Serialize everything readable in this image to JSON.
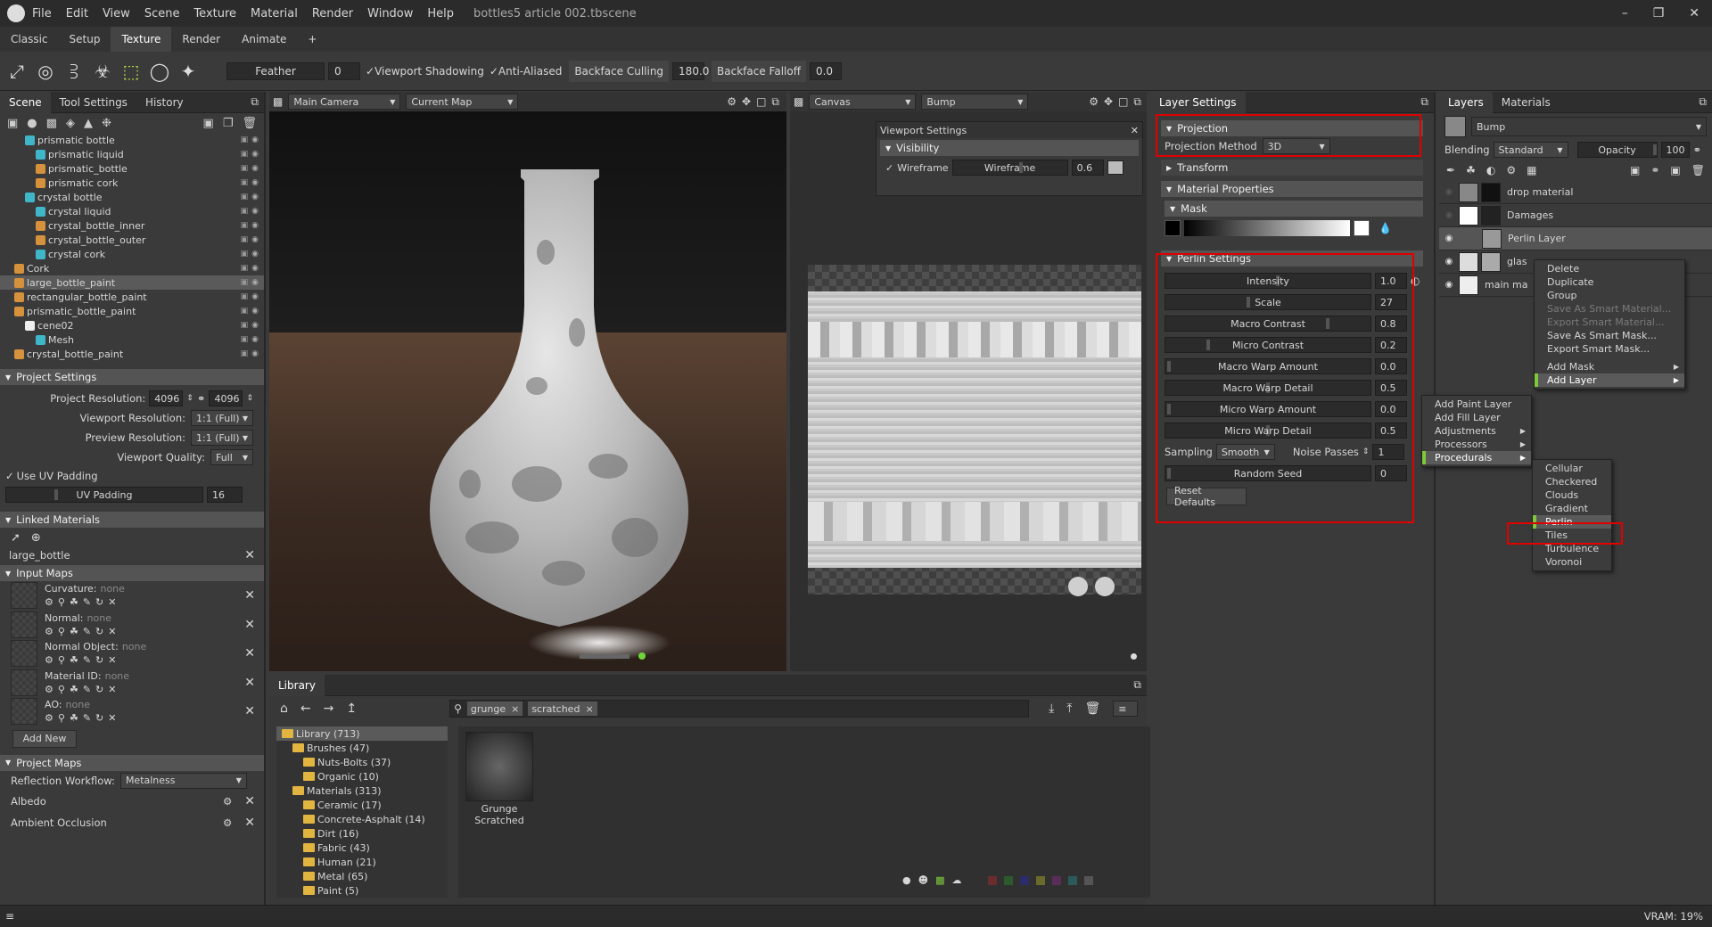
{
  "app": {
    "menu": [
      "File",
      "Edit",
      "View",
      "Scene",
      "Texture",
      "Material",
      "Render",
      "Window",
      "Help"
    ],
    "doc_title": "bottles5 article 002.tbscene"
  },
  "workspace_tabs": [
    "Classic",
    "Setup",
    "Texture",
    "Render",
    "Animate",
    "+"
  ],
  "toolbar": {
    "feather_label": "Feather",
    "feather_value": "0",
    "viewport_shadowing": "Viewport Shadowing",
    "anti_aliased": "Anti-Aliased",
    "backface_culling": "Backface Culling",
    "backface_culling_value": "180.0",
    "backface_falloff": "Backface Falloff",
    "backface_falloff_value": "0.0"
  },
  "left_panel": {
    "tabs": [
      "Scene",
      "Tool Settings",
      "History"
    ],
    "tree": [
      {
        "label": "prismatic bottle",
        "indent": 1,
        "icon": "c-teal"
      },
      {
        "label": "prismatic liquid",
        "indent": 2,
        "icon": "c-teal"
      },
      {
        "label": "prismatic_bottle",
        "indent": 2,
        "icon": "c-or"
      },
      {
        "label": "prismatic cork",
        "indent": 2,
        "icon": "c-or"
      },
      {
        "label": "crystal bottle",
        "indent": 1,
        "icon": "c-teal"
      },
      {
        "label": "crystal liquid",
        "indent": 2,
        "icon": "c-teal"
      },
      {
        "label": "crystal_bottle_inner",
        "indent": 2,
        "icon": "c-or"
      },
      {
        "label": "crystal_bottle_outer",
        "indent": 2,
        "icon": "c-or"
      },
      {
        "label": "crystal cork",
        "indent": 2,
        "icon": "c-teal"
      },
      {
        "label": "Cork",
        "indent": 0,
        "icon": "c-or"
      },
      {
        "label": "large_bottle_paint",
        "indent": 0,
        "icon": "c-or",
        "sel": true
      },
      {
        "label": "rectangular_bottle_paint",
        "indent": 0,
        "icon": "c-or"
      },
      {
        "label": "prismatic_bottle_paint",
        "indent": 0,
        "icon": "c-or"
      },
      {
        "label": "cene02",
        "indent": 1,
        "icon": "c-white"
      },
      {
        "label": "Mesh",
        "indent": 2,
        "icon": "c-teal"
      },
      {
        "label": "crystal_bottle_paint",
        "indent": 0,
        "icon": "c-or"
      }
    ],
    "project_settings": {
      "header": "Project Settings",
      "resolution_label": "Project Resolution:",
      "res_w": "4096",
      "res_h": "4096",
      "viewport_res_label": "Viewport Resolution:",
      "viewport_res": "1:1 (Full)",
      "preview_res_label": "Preview Resolution:",
      "preview_res": "1:1 (Full)",
      "viewport_quality_label": "Viewport Quality:",
      "viewport_quality": "Full",
      "use_uv_padding": "Use UV Padding",
      "uv_padding_label": "UV Padding",
      "uv_padding": "16"
    },
    "linked_materials": {
      "header": "Linked Materials",
      "item": "large_bottle"
    },
    "input_maps": {
      "header": "Input Maps",
      "maps": [
        {
          "name": "Curvature:",
          "value": "none"
        },
        {
          "name": "Normal:",
          "value": "none"
        },
        {
          "name": "Normal Object:",
          "value": "none"
        },
        {
          "name": "Material ID:",
          "value": "none"
        },
        {
          "name": "AO:",
          "value": "none"
        }
      ],
      "add_new": "Add New"
    },
    "project_maps": {
      "header": "Project Maps",
      "workflow_label": "Reflection Workflow:",
      "workflow": "Metalness",
      "maps": [
        "Albedo",
        "Ambient Occlusion"
      ]
    }
  },
  "viewport": {
    "camera": "Main Camera",
    "map": "Current Map"
  },
  "canvas": {
    "mode": "Canvas",
    "channel": "Bump",
    "vs_title": "Viewport Settings",
    "visibility": "Visibility",
    "wireframe": "Wireframe",
    "wireframe_label": "Wireframe",
    "wireframe_value": "0.6"
  },
  "library": {
    "title": "Library",
    "tags": [
      "grunge",
      "scratched"
    ],
    "tree": [
      {
        "label": "Library (713)",
        "indent": 0
      },
      {
        "label": "Brushes (47)",
        "indent": 1
      },
      {
        "label": "Nuts-Bolts (37)",
        "indent": 2
      },
      {
        "label": "Organic (10)",
        "indent": 2
      },
      {
        "label": "Materials (313)",
        "indent": 1
      },
      {
        "label": "Ceramic (17)",
        "indent": 2
      },
      {
        "label": "Concrete-Asphalt (14)",
        "indent": 2
      },
      {
        "label": "Dirt (16)",
        "indent": 2
      },
      {
        "label": "Fabric (43)",
        "indent": 2
      },
      {
        "label": "Human (21)",
        "indent": 2
      },
      {
        "label": "Metal (65)",
        "indent": 2
      },
      {
        "label": "Paint (5)",
        "indent": 2
      }
    ],
    "item_line1": "Grunge",
    "item_line2": "Scratched"
  },
  "layer_settings": {
    "title": "Layer Settings",
    "projection_header": "Projection",
    "projection_method_label": "Projection Method",
    "projection_method": "3D",
    "transform": "Transform",
    "material_properties": "Material Properties",
    "mask": "Mask",
    "perlin_header": "Perlin Settings",
    "params": [
      {
        "label": "Intensity",
        "value": "1.0",
        "knob": 0.55
      },
      {
        "label": "Scale",
        "value": "27",
        "knob": 0.4
      },
      {
        "label": "Macro Contrast",
        "value": "0.8",
        "knob": 0.8
      },
      {
        "label": "Micro Contrast",
        "value": "0.2",
        "knob": 0.2
      },
      {
        "label": "Macro Warp Amount",
        "value": "0.0",
        "knob": 0.0
      },
      {
        "label": "Macro Warp Detail",
        "value": "0.5",
        "knob": 0.5
      },
      {
        "label": "Micro Warp Amount",
        "value": "0.0",
        "knob": 0.0
      },
      {
        "label": "Micro Warp Detail",
        "value": "0.5",
        "knob": 0.5
      }
    ],
    "sampling_label": "Sampling",
    "sampling": "Smooth",
    "noise_passes_label": "Noise Passes",
    "noise_passes": "1",
    "random_seed": "Random Seed",
    "random_seed_value": "0",
    "reset": "Reset Defaults"
  },
  "layers": {
    "tabs": [
      "Layers",
      "Materials"
    ],
    "channel": "Bump",
    "blending_label": "Blending",
    "blending": "Standard",
    "opacity_label": "Opacity",
    "opacity": "100",
    "rows": [
      {
        "name": "drop material"
      },
      {
        "name": "Damages"
      },
      {
        "name": "Perlin Layer"
      },
      {
        "name": "glas"
      },
      {
        "name": "main ma"
      }
    ]
  },
  "context_menu": {
    "items": [
      {
        "label": "Delete"
      },
      {
        "label": "Duplicate"
      },
      {
        "label": "Group"
      },
      {
        "label": "Save As Smart Material...",
        "dis": true
      },
      {
        "label": "Export Smart Material...",
        "dis": true
      },
      {
        "label": "Save As Smart Mask..."
      },
      {
        "label": "Export Smart Mask..."
      },
      {
        "label": "Add Mask",
        "sub": true
      },
      {
        "label": "Add Layer",
        "sub": true,
        "hl": true
      }
    ]
  },
  "add_layer_menu": {
    "items": [
      {
        "label": "Add Paint Layer"
      },
      {
        "label": "Add Fill Layer"
      },
      {
        "label": "Adjustments",
        "sub": true
      },
      {
        "label": "Processors",
        "sub": true
      },
      {
        "label": "Procedurals",
        "sub": true,
        "hl": true
      }
    ]
  },
  "procedurals_menu": {
    "items": [
      {
        "label": "Cellular"
      },
      {
        "label": "Checkered"
      },
      {
        "label": "Clouds"
      },
      {
        "label": "Gradient"
      },
      {
        "label": "Perlin",
        "hl": true
      },
      {
        "label": "Tiles"
      },
      {
        "label": "Turbulence"
      },
      {
        "label": "Voronoi"
      }
    ]
  },
  "status": {
    "vram": "VRAM: 19%"
  },
  "colors": {
    "accent": "#7ec83a",
    "highlight_box": "#e00000",
    "teal": "#3fb7c9",
    "orange": "#d6913c"
  }
}
